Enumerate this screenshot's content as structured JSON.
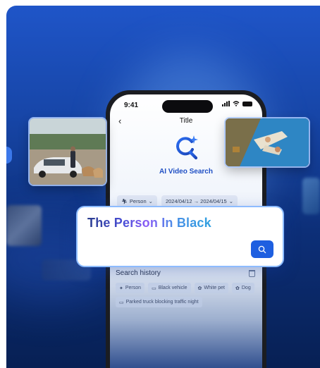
{
  "phone": {
    "time": "9:41",
    "title": "Title",
    "app_name": "AI Video Search",
    "filters": {
      "object": "Person",
      "date_range": "2024/04/12 → 2024/04/15"
    }
  },
  "search": {
    "query": "The Person In Black"
  },
  "history": {
    "title": "Search history",
    "tags": [
      "Person",
      "Black vehicle",
      "White pet",
      "Dog",
      "Parked truck blocking traffic night"
    ]
  },
  "colors": {
    "accent": "#1e5fe0",
    "background_top": "#1f55c8",
    "background_bottom": "#072054"
  },
  "icons": [
    "back-chevron",
    "ai-search-logo",
    "person-icon",
    "calendar-arrow",
    "search-icon",
    "trash-icon",
    "car-icon",
    "pet-icon"
  ]
}
